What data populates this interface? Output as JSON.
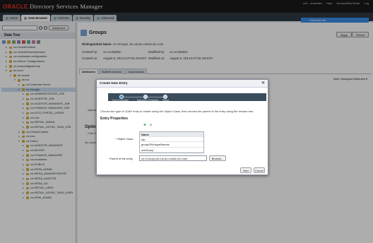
{
  "header": {
    "brand_oracle": "ORACLE",
    "brand_product": "Directory Services Manager",
    "links": [
      "ovd - oracledev",
      "Help",
      "Accessibility Mode",
      "Log"
    ]
  },
  "tabs": [
    {
      "label": "Home"
    },
    {
      "label": "Data Browser"
    },
    {
      "label": "Schema"
    },
    {
      "label": "Security"
    },
    {
      "label": "Advanced"
    }
  ],
  "duplicate_tab_label": "Duplicate tab",
  "left": {
    "advanced_label": "Advanced",
    "data_tree_label": "Data Tree",
    "tree": [
      {
        "label": "cn=OracleContext",
        "indent": 1,
        "toggle": "▸"
      },
      {
        "label": "cn=OracleSchemaVersion",
        "indent": 1,
        "toggle": "▸"
      },
      {
        "label": "cn=replication configuration",
        "indent": 1,
        "toggle": "▸"
      },
      {
        "label": "cn=Server Configurations",
        "indent": 1,
        "toggle": "▸"
      },
      {
        "label": "cn=subconfigsubentry",
        "indent": 1,
        "toggle": "▸"
      },
      {
        "label": "dc=com",
        "indent": 1,
        "toggle": "▾"
      },
      {
        "label": "dc=oracle",
        "indent": 2,
        "toggle": "▾"
      },
      {
        "label": "dc=us",
        "indent": 3,
        "toggle": "▾"
      },
      {
        "label": "cn=Calendar Server",
        "indent": 4,
        "toggle": "▸"
      },
      {
        "label": "cn=Groups",
        "indent": 4,
        "toggle": "▾",
        "selected": true
      },
      {
        "label": "cn=ADMINISTRATOR_JOB",
        "indent": 5,
        "toggle": "▸"
      },
      {
        "label": "cn=AUDITOR_JOB",
        "indent": 5,
        "toggle": "▸"
      },
      {
        "label": "cn=AUDITOR_MANAGER_JOB",
        "indent": 5,
        "toggle": "▸"
      },
      {
        "label": "cn=FINANCE_MANAGER_JOB",
        "indent": 5,
        "toggle": "▸"
      },
      {
        "label": "cn=OCS_PORTAL_USERS",
        "indent": 5,
        "toggle": "▸"
      },
      {
        "label": "cn=ocs",
        "indent": 5,
        "toggle": "▸"
      },
      {
        "label": "cn=RETAIL_ADMIN",
        "indent": 5,
        "toggle": "▸"
      },
      {
        "label": "cn=RETAIL_ASYNC_TASK_JOB",
        "indent": 5,
        "toggle": "▸"
      },
      {
        "label": "cn=OracleContext",
        "indent": 4,
        "toggle": "▸"
      },
      {
        "label": "cn=ocs",
        "indent": 4,
        "toggle": "▸"
      },
      {
        "label": "cn=Users",
        "indent": 4,
        "toggle": "▾"
      },
      {
        "label": "cn=AUDITOR_MANAGER",
        "indent": 5,
        "toggle": "▸"
      },
      {
        "label": "cn=BUYER",
        "indent": 5,
        "toggle": "▸"
      },
      {
        "label": "cn=FINANCE_MANAGER",
        "indent": 5,
        "toggle": "▸"
      },
      {
        "label": "cn=orcladmin",
        "indent": 5,
        "toggle": "▸"
      },
      {
        "label": "cn=PUBLIC",
        "indent": 5,
        "toggle": "▸"
      },
      {
        "label": "cn=REIM_ADMIN",
        "indent": 5,
        "toggle": "▸"
      },
      {
        "label": "cn=RESA_ADMINISTRATOR",
        "indent": 5,
        "toggle": "▸"
      },
      {
        "label": "cn=RESA_AUDITOR",
        "indent": 5,
        "toggle": "▸"
      },
      {
        "label": "cn=RESA_SU",
        "indent": 5,
        "toggle": "▸"
      },
      {
        "label": "cn=RETAIL_USER",
        "indent": 5,
        "toggle": "▸"
      },
      {
        "label": "cn=RETAIL_ASYNC_TASK_USER",
        "indent": 5,
        "toggle": "▸"
      },
      {
        "label": "cn=RPM_ADMIN",
        "indent": 5,
        "toggle": "▸"
      }
    ]
  },
  "main": {
    "title": "Groups",
    "apply_label": "Apply",
    "revert_label": "Revert",
    "dn_label": "Distinguished Name:",
    "dn_value": "cn=Groups, dc=us,dc=oracle,dc=com",
    "created_by_label": "Created by:",
    "created_by_value": "cn=orcladmin",
    "created_on_label": "Created on:",
    "created_on_value": "August 5, 2014 8:47:02 AM EST",
    "modified_by_label": "Modified by:",
    "modified_by_value": "cn=orcladmin",
    "modified_on_label": "Modified on:",
    "modified_on_value": "August 5, 2014 8:47:02 AM EST",
    "subtabs": [
      "Attributes",
      "Subtree Access",
      "Local Access"
    ],
    "view_label": "View: Managed Attributes ▾",
    "bg_cn": "* cn",
    "bg_objectclass": "objectclass",
    "optional_heading": "Optional Attr",
    "optional_click": "Click to ma",
    "no_optional": "No optional attrib"
  },
  "dialog": {
    "title": "Create New Entry",
    "close": "✕",
    "train": [
      "Entry Properties",
      "Mandatory Properties",
      "Status"
    ],
    "instruction": "Choose the type of LDAP entry to create using the Object Class, then choose the parent of the entry using the browse tree.",
    "section_title": "Entry Properties",
    "object_class_label": "* Object Class",
    "table_header": "Name",
    "object_classes": [
      "top",
      "groupOfUniqueNames",
      "orclGroup"
    ],
    "parent_label": "Parent of the entry",
    "parent_value": "cn=Groups,dc=us,dc=oracle,dc=com",
    "browse_label": "Browse...",
    "next_label": "Next",
    "cancel_label": "Cancel"
  }
}
